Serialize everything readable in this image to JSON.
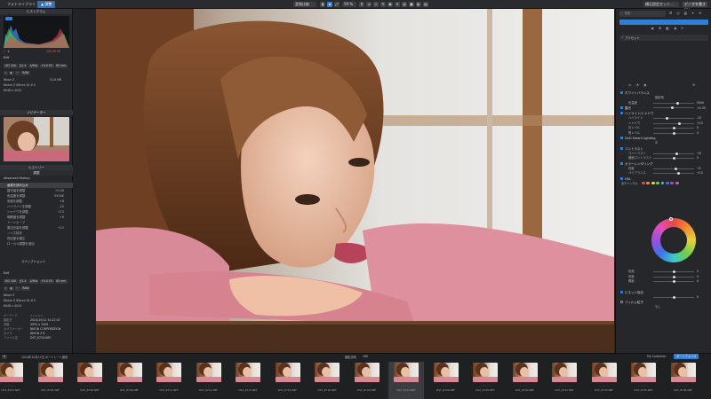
{
  "topbar": {
    "tab_browse": "フォトライブラリ",
    "tab_edit": "▲ 調整",
    "compare_label": "変換比較",
    "zoom_value": "59 %",
    "export_label": "構石設定セット...",
    "export_button": "データを書き出し"
  },
  "left_panel": {
    "histogram_header": "ヒストグラム",
    "histogram_values": "100  95  89",
    "info_title": "Exif",
    "chips_row1": [
      "ISO 100",
      "ƒ/1.4",
      "1/80s",
      "+0.0 EV",
      "85 mm"
    ],
    "chips_row2": [
      "⌗",
      "◐",
      "···",
      "RAW"
    ],
    "camera": "Nikon Z",
    "lens": "Nikkor Z 85mm f/1.8 S",
    "dims": "6048 x 4024",
    "file_size": "51.6 MB",
    "loupe_header": "ナビゲーター",
    "history_header": "ヒストリー",
    "history_sub": "調整",
    "history_group": "Advanced History",
    "history_items": [
      "画像を読み込み",
      "露光量を調整",
      "色温度を調整",
      "彩度を調整",
      "ハイライトを調整",
      "シャドウを調整",
      "明瞭度を調整",
      "トーンカーブ",
      "周辺光量を調整",
      "ノイズ除去",
      "色収差を補正",
      "ローカル調整を追加"
    ],
    "history_values": [
      "+0.30",
      "5500K",
      "+8",
      "-22",
      "+15",
      "+6",
      "",
      "",
      "+12",
      "",
      "",
      ""
    ],
    "snapshot_button": "スナップショット",
    "exif2_title": "Exif",
    "meta_keys": [
      "キーワード",
      "撮影日",
      "評価",
      "カメラメーカー",
      "カメラ",
      "ファイル名"
    ],
    "meta_values": [
      "☆☆☆☆☆",
      "2024/10/12 14:22:07",
      "4955 x 3309",
      "NIKON CORPORATION",
      "NIKON Z 8",
      "DST_8724.NEF"
    ]
  },
  "right_panel": {
    "search_placeholder": "検索",
    "preset_label": "プリセット",
    "section_wb": "ホワイトバランス",
    "wb_mode": "撮影時",
    "rows": [
      {
        "label": "色温度",
        "value": "5500"
      },
      {
        "label": "色かぶり",
        "value": "+6"
      }
    ],
    "section_exposure": "露光",
    "exposure_value": "+0.30",
    "section_tone": "ハイライト/シャドウ",
    "tone_rows": [
      {
        "label": "ハイライト",
        "value": "-22"
      },
      {
        "label": "シャドウ",
        "value": "+15"
      },
      {
        "label": "白レベル",
        "value": "0"
      },
      {
        "label": "黒レベル",
        "value": "0"
      }
    ],
    "section_smart": "DxO Smart Lighting",
    "smart_value": "中",
    "section_contrast": "コントラスト",
    "contrast_rows": [
      {
        "label": "コントラスト",
        "value": "+8"
      },
      {
        "label": "微細コントラスト",
        "value": "0"
      }
    ],
    "section_color": "カラーレンダリング",
    "color_rows": [
      {
        "label": "彩度",
        "value": "+5"
      },
      {
        "label": "バイブランス",
        "value": "+10"
      }
    ],
    "section_hsl": "HSL",
    "hsl_mode": "全チャンネル",
    "swatch_colors": [
      "#e84646",
      "#ef8a2e",
      "#e8d23a",
      "#6dcf48",
      "#3ec6c9",
      "#3d74e6",
      "#9a4fe0",
      "#e04fb8",
      "#cccccc"
    ],
    "hsl_rows": [
      {
        "label": "色相",
        "value": "0"
      },
      {
        "label": "彩度",
        "value": "0"
      },
      {
        "label": "輝度",
        "value": "0"
      }
    ],
    "section_vignette": "ビネット除去",
    "vignette_value": "0",
    "section_grain": "フィルム粒子",
    "grain_value": "なし"
  },
  "filmstrip": {
    "sort_label": "撮影日時",
    "count": "180",
    "path_label": "2024年10月12日 ポートレート撮影",
    "collection_label": "My Collection",
    "active_label": "ポートフォリオ",
    "thumbs": [
      "DST_8703.NEF",
      "DST_8705.NEF",
      "DST_8708.NEF",
      "DST_8709.NEF",
      "DST_8711.NEF",
      "DST_8712.NEF",
      "DST_8714.NEF",
      "DST_8716.NEF",
      "DST_8718.NEF",
      "DST_8720.NEF",
      "DST_8724.NEF",
      "DST_8726.NEF",
      "DST_8728.NEF",
      "DST_8730.NEF",
      "DST_8731.NEF",
      "DST_8733.NEF",
      "DST_8735.NEF",
      "DST_8738.NEF"
    ],
    "stars": "☆☆☆☆☆"
  },
  "colors": {
    "accent": "#2f7fd6",
    "panel": "#26272a",
    "background": "#1c1d1f"
  }
}
